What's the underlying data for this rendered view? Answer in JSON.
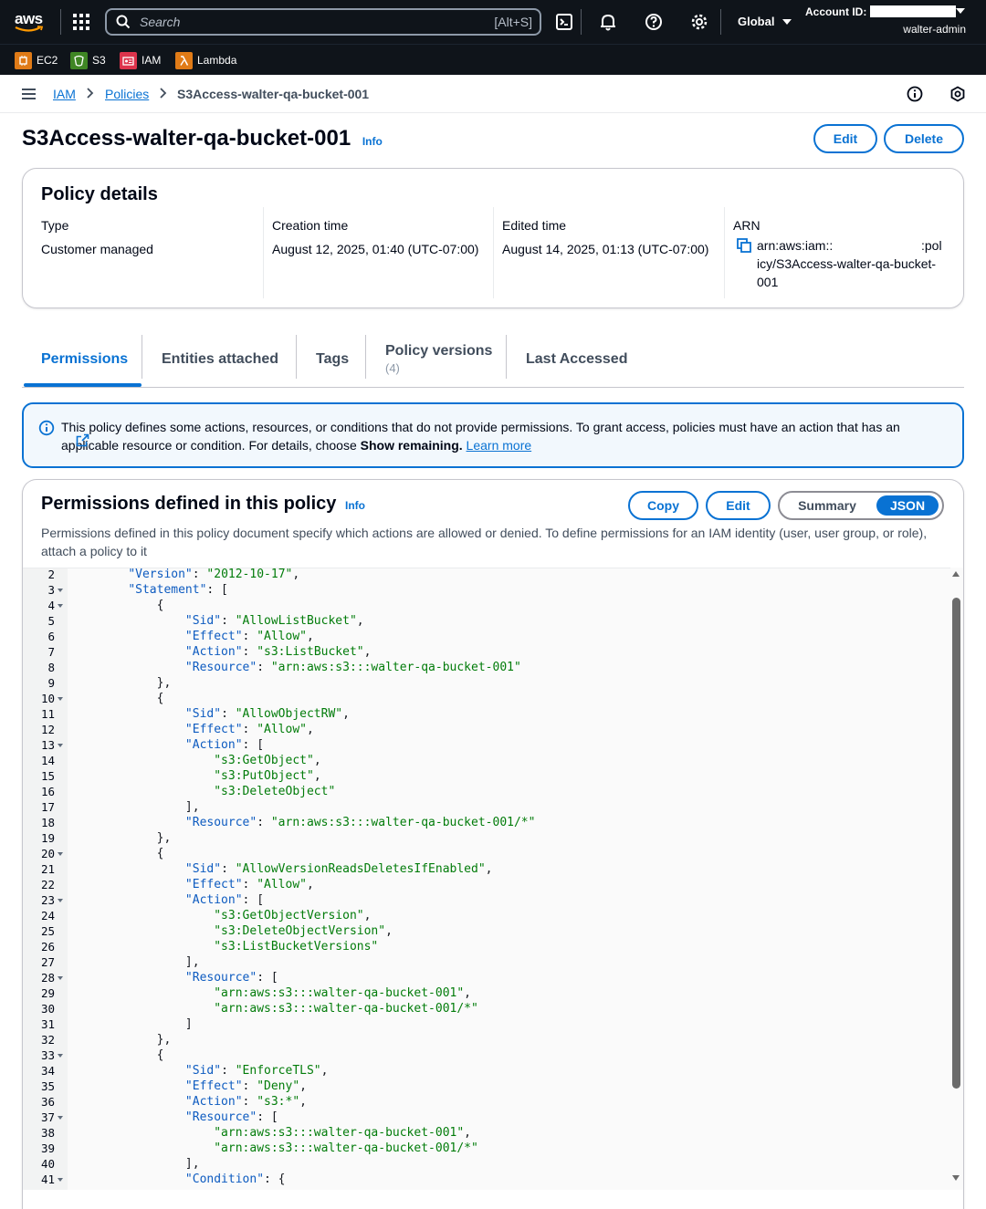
{
  "topnav": {
    "logo_text": "aws",
    "search_placeholder": "Search",
    "search_shortcut": "[Alt+S]",
    "region": "Global",
    "account_label": "Account ID:",
    "username": "walter-admin"
  },
  "favorites": [
    {
      "label": "EC2",
      "icon": "ec2-icon",
      "color": "#e07b17"
    },
    {
      "label": "S3",
      "icon": "s3-icon",
      "color": "#3f8624"
    },
    {
      "label": "IAM",
      "icon": "iam-icon",
      "color": "#dd344c"
    },
    {
      "label": "Lambda",
      "icon": "lambda-icon",
      "color": "#e07b17"
    }
  ],
  "breadcrumb": {
    "items": [
      "IAM",
      "Policies"
    ],
    "current": "S3Access-walter-qa-bucket-001"
  },
  "header": {
    "title": "S3Access-walter-qa-bucket-001",
    "info": "Info",
    "edit": "Edit",
    "delete": "Delete"
  },
  "details": {
    "title": "Policy details",
    "type_label": "Type",
    "type_value": "Customer managed",
    "creation_label": "Creation time",
    "creation_value": "August 12, 2025, 01:40 (UTC-07:00)",
    "edited_label": "Edited time",
    "edited_value": "August 14, 2025, 01:13 (UTC-07:00)",
    "arn_label": "ARN",
    "arn_line1a": "arn:aws:iam::",
    "arn_line1b": ":pol",
    "arn_line2": "icy/S3Access-walter-qa-bucket-",
    "arn_line3": "001"
  },
  "tabs": {
    "permissions": "Permissions",
    "entities": "Entities attached",
    "tags": "Tags",
    "versions": "Policy versions",
    "versions_count": "(4)",
    "last_accessed": "Last Accessed"
  },
  "alert": {
    "text": "This policy defines some actions, resources, or conditions that do not provide permissions. To grant access, policies must have an action that has an applicable resource or condition. For details, choose ",
    "bold": "Show remaining.",
    "link": "Learn more"
  },
  "permissions": {
    "title": "Permissions defined in this policy",
    "info": "Info",
    "copy": "Copy",
    "edit": "Edit",
    "summary": "Summary",
    "json": "JSON",
    "description": "Permissions defined in this policy document specify which actions are allowed or denied. To define permissions for an IAM identity (user, user group, or role), attach a policy to it"
  },
  "code_lines": [
    {
      "n": "2",
      "fold": false,
      "text": "    \"Version\": \"2012-10-17\","
    },
    {
      "n": "3",
      "fold": true,
      "text": "    \"Statement\": ["
    },
    {
      "n": "4",
      "fold": true,
      "text": "        {"
    },
    {
      "n": "5",
      "fold": false,
      "text": "            \"Sid\": \"AllowListBucket\","
    },
    {
      "n": "6",
      "fold": false,
      "text": "            \"Effect\": \"Allow\","
    },
    {
      "n": "7",
      "fold": false,
      "text": "            \"Action\": \"s3:ListBucket\","
    },
    {
      "n": "8",
      "fold": false,
      "text": "            \"Resource\": \"arn:aws:s3:::walter-qa-bucket-001\""
    },
    {
      "n": "9",
      "fold": false,
      "text": "        },"
    },
    {
      "n": "10",
      "fold": true,
      "text": "        {"
    },
    {
      "n": "11",
      "fold": false,
      "text": "            \"Sid\": \"AllowObjectRW\","
    },
    {
      "n": "12",
      "fold": false,
      "text": "            \"Effect\": \"Allow\","
    },
    {
      "n": "13",
      "fold": true,
      "text": "            \"Action\": ["
    },
    {
      "n": "14",
      "fold": false,
      "text": "                \"s3:GetObject\","
    },
    {
      "n": "15",
      "fold": false,
      "text": "                \"s3:PutObject\","
    },
    {
      "n": "16",
      "fold": false,
      "text": "                \"s3:DeleteObject\""
    },
    {
      "n": "17",
      "fold": false,
      "text": "            ],"
    },
    {
      "n": "18",
      "fold": false,
      "text": "            \"Resource\": \"arn:aws:s3:::walter-qa-bucket-001/*\""
    },
    {
      "n": "19",
      "fold": false,
      "text": "        },"
    },
    {
      "n": "20",
      "fold": true,
      "text": "        {"
    },
    {
      "n": "21",
      "fold": false,
      "text": "            \"Sid\": \"AllowVersionReadsDeletesIfEnabled\","
    },
    {
      "n": "22",
      "fold": false,
      "text": "            \"Effect\": \"Allow\","
    },
    {
      "n": "23",
      "fold": true,
      "text": "            \"Action\": ["
    },
    {
      "n": "24",
      "fold": false,
      "text": "                \"s3:GetObjectVersion\","
    },
    {
      "n": "25",
      "fold": false,
      "text": "                \"s3:DeleteObjectVersion\","
    },
    {
      "n": "26",
      "fold": false,
      "text": "                \"s3:ListBucketVersions\""
    },
    {
      "n": "27",
      "fold": false,
      "text": "            ],"
    },
    {
      "n": "28",
      "fold": true,
      "text": "            \"Resource\": ["
    },
    {
      "n": "29",
      "fold": false,
      "text": "                \"arn:aws:s3:::walter-qa-bucket-001\","
    },
    {
      "n": "30",
      "fold": false,
      "text": "                \"arn:aws:s3:::walter-qa-bucket-001/*\""
    },
    {
      "n": "31",
      "fold": false,
      "text": "            ]"
    },
    {
      "n": "32",
      "fold": false,
      "text": "        },"
    },
    {
      "n": "33",
      "fold": true,
      "text": "        {"
    },
    {
      "n": "34",
      "fold": false,
      "text": "            \"Sid\": \"EnforceTLS\","
    },
    {
      "n": "35",
      "fold": false,
      "text": "            \"Effect\": \"Deny\","
    },
    {
      "n": "36",
      "fold": false,
      "text": "            \"Action\": \"s3:*\","
    },
    {
      "n": "37",
      "fold": true,
      "text": "            \"Resource\": ["
    },
    {
      "n": "38",
      "fold": false,
      "text": "                \"arn:aws:s3:::walter-qa-bucket-001\","
    },
    {
      "n": "39",
      "fold": false,
      "text": "                \"arn:aws:s3:::walter-qa-bucket-001/*\""
    },
    {
      "n": "40",
      "fold": false,
      "text": "            ],"
    },
    {
      "n": "41",
      "fold": true,
      "text": "            \"Condition\": {"
    }
  ],
  "colors": {
    "accent": "#0972d3",
    "nav_bg": "#0f141a",
    "json_key": "#0d5bc0",
    "json_string": "#027c0a"
  }
}
